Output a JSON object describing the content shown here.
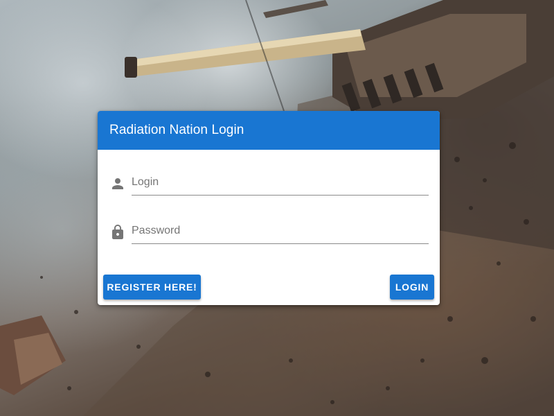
{
  "card": {
    "title": "Radiation Nation Login"
  },
  "form": {
    "login": {
      "placeholder": "Login",
      "value": "",
      "icon": "person-icon"
    },
    "password": {
      "placeholder": "Password",
      "value": "",
      "icon": "lock-icon"
    }
  },
  "actions": {
    "register_label": "REGISTER HERE!",
    "login_label": "LOGIN"
  },
  "colors": {
    "primary": "#1976d2",
    "icon": "#757575",
    "card_bg": "#ffffff"
  }
}
